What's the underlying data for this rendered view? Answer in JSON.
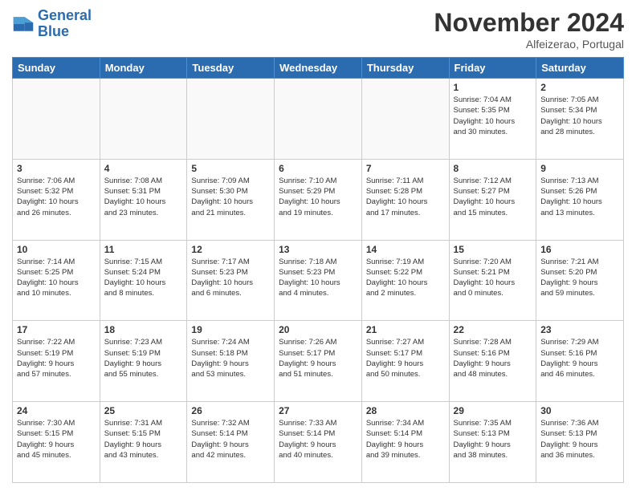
{
  "logo": {
    "line1": "General",
    "line2": "Blue"
  },
  "header": {
    "month": "November 2024",
    "location": "Alfeizerao, Portugal"
  },
  "weekdays": [
    "Sunday",
    "Monday",
    "Tuesday",
    "Wednesday",
    "Thursday",
    "Friday",
    "Saturday"
  ],
  "weeks": [
    [
      {
        "day": "",
        "info": "",
        "empty": true
      },
      {
        "day": "",
        "info": "",
        "empty": true
      },
      {
        "day": "",
        "info": "",
        "empty": true
      },
      {
        "day": "",
        "info": "",
        "empty": true
      },
      {
        "day": "",
        "info": "",
        "empty": true
      },
      {
        "day": "1",
        "info": "Sunrise: 7:04 AM\nSunset: 5:35 PM\nDaylight: 10 hours\nand 30 minutes."
      },
      {
        "day": "2",
        "info": "Sunrise: 7:05 AM\nSunset: 5:34 PM\nDaylight: 10 hours\nand 28 minutes."
      }
    ],
    [
      {
        "day": "3",
        "info": "Sunrise: 7:06 AM\nSunset: 5:32 PM\nDaylight: 10 hours\nand 26 minutes."
      },
      {
        "day": "4",
        "info": "Sunrise: 7:08 AM\nSunset: 5:31 PM\nDaylight: 10 hours\nand 23 minutes."
      },
      {
        "day": "5",
        "info": "Sunrise: 7:09 AM\nSunset: 5:30 PM\nDaylight: 10 hours\nand 21 minutes."
      },
      {
        "day": "6",
        "info": "Sunrise: 7:10 AM\nSunset: 5:29 PM\nDaylight: 10 hours\nand 19 minutes."
      },
      {
        "day": "7",
        "info": "Sunrise: 7:11 AM\nSunset: 5:28 PM\nDaylight: 10 hours\nand 17 minutes."
      },
      {
        "day": "8",
        "info": "Sunrise: 7:12 AM\nSunset: 5:27 PM\nDaylight: 10 hours\nand 15 minutes."
      },
      {
        "day": "9",
        "info": "Sunrise: 7:13 AM\nSunset: 5:26 PM\nDaylight: 10 hours\nand 13 minutes."
      }
    ],
    [
      {
        "day": "10",
        "info": "Sunrise: 7:14 AM\nSunset: 5:25 PM\nDaylight: 10 hours\nand 10 minutes."
      },
      {
        "day": "11",
        "info": "Sunrise: 7:15 AM\nSunset: 5:24 PM\nDaylight: 10 hours\nand 8 minutes."
      },
      {
        "day": "12",
        "info": "Sunrise: 7:17 AM\nSunset: 5:23 PM\nDaylight: 10 hours\nand 6 minutes."
      },
      {
        "day": "13",
        "info": "Sunrise: 7:18 AM\nSunset: 5:23 PM\nDaylight: 10 hours\nand 4 minutes."
      },
      {
        "day": "14",
        "info": "Sunrise: 7:19 AM\nSunset: 5:22 PM\nDaylight: 10 hours\nand 2 minutes."
      },
      {
        "day": "15",
        "info": "Sunrise: 7:20 AM\nSunset: 5:21 PM\nDaylight: 10 hours\nand 0 minutes."
      },
      {
        "day": "16",
        "info": "Sunrise: 7:21 AM\nSunset: 5:20 PM\nDaylight: 9 hours\nand 59 minutes."
      }
    ],
    [
      {
        "day": "17",
        "info": "Sunrise: 7:22 AM\nSunset: 5:19 PM\nDaylight: 9 hours\nand 57 minutes."
      },
      {
        "day": "18",
        "info": "Sunrise: 7:23 AM\nSunset: 5:19 PM\nDaylight: 9 hours\nand 55 minutes."
      },
      {
        "day": "19",
        "info": "Sunrise: 7:24 AM\nSunset: 5:18 PM\nDaylight: 9 hours\nand 53 minutes."
      },
      {
        "day": "20",
        "info": "Sunrise: 7:26 AM\nSunset: 5:17 PM\nDaylight: 9 hours\nand 51 minutes."
      },
      {
        "day": "21",
        "info": "Sunrise: 7:27 AM\nSunset: 5:17 PM\nDaylight: 9 hours\nand 50 minutes."
      },
      {
        "day": "22",
        "info": "Sunrise: 7:28 AM\nSunset: 5:16 PM\nDaylight: 9 hours\nand 48 minutes."
      },
      {
        "day": "23",
        "info": "Sunrise: 7:29 AM\nSunset: 5:16 PM\nDaylight: 9 hours\nand 46 minutes."
      }
    ],
    [
      {
        "day": "24",
        "info": "Sunrise: 7:30 AM\nSunset: 5:15 PM\nDaylight: 9 hours\nand 45 minutes."
      },
      {
        "day": "25",
        "info": "Sunrise: 7:31 AM\nSunset: 5:15 PM\nDaylight: 9 hours\nand 43 minutes."
      },
      {
        "day": "26",
        "info": "Sunrise: 7:32 AM\nSunset: 5:14 PM\nDaylight: 9 hours\nand 42 minutes."
      },
      {
        "day": "27",
        "info": "Sunrise: 7:33 AM\nSunset: 5:14 PM\nDaylight: 9 hours\nand 40 minutes."
      },
      {
        "day": "28",
        "info": "Sunrise: 7:34 AM\nSunset: 5:14 PM\nDaylight: 9 hours\nand 39 minutes."
      },
      {
        "day": "29",
        "info": "Sunrise: 7:35 AM\nSunset: 5:13 PM\nDaylight: 9 hours\nand 38 minutes."
      },
      {
        "day": "30",
        "info": "Sunrise: 7:36 AM\nSunset: 5:13 PM\nDaylight: 9 hours\nand 36 minutes."
      }
    ]
  ]
}
